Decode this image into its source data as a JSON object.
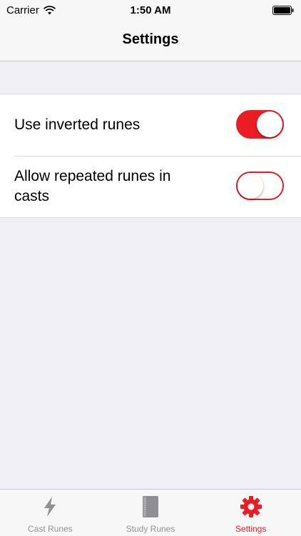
{
  "status_bar": {
    "carrier": "Carrier",
    "time": "1:50 AM"
  },
  "nav": {
    "title": "Settings"
  },
  "settings": [
    {
      "label": "Use inverted runes",
      "on": true
    },
    {
      "label": "Allow repeated runes in casts",
      "on": false
    }
  ],
  "tabs": [
    {
      "label": "Cast Runes",
      "icon": "lightning-icon",
      "active": false
    },
    {
      "label": "Study Runes",
      "icon": "book-icon",
      "active": false
    },
    {
      "label": "Settings",
      "icon": "gear-icon",
      "active": true
    }
  ],
  "colors": {
    "accent": "#ec1c24",
    "background": "#efeff4",
    "inactive": "#929292"
  }
}
